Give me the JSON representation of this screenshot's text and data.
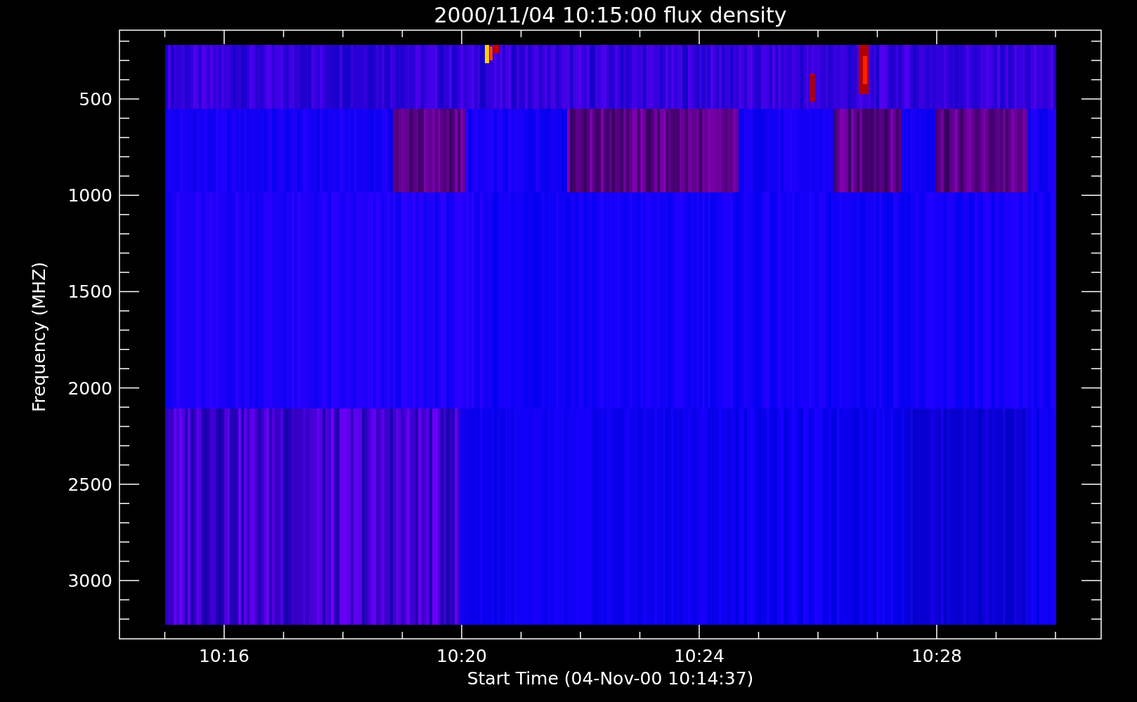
{
  "title": "2000/11/04 10:15:00 flux density",
  "y_axis": {
    "label": "Frequency (MHZ)",
    "ticks": [
      "500",
      "1000",
      "1500",
      "2000",
      "2500",
      "3000"
    ]
  },
  "x_axis": {
    "label": "Start Time (04-Nov-00 10:14:37)",
    "ticks": [
      "10:16",
      "10:20",
      "10:24",
      "10:28"
    ]
  }
}
